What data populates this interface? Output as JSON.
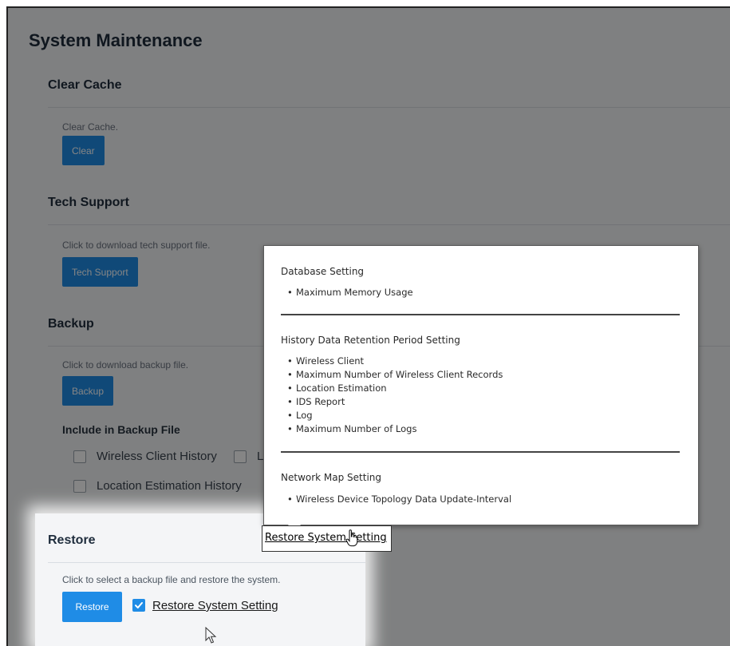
{
  "page": {
    "title": "System Maintenance"
  },
  "clear_cache": {
    "title": "Clear Cache",
    "description": "Clear Cache.",
    "button": "Clear"
  },
  "tech_support": {
    "title": "Tech Support",
    "description": "Click to download tech support file.",
    "button": "Tech Support"
  },
  "backup": {
    "title": "Backup",
    "description": "Click to download backup file.",
    "button": "Backup",
    "include_label": "Include in Backup File",
    "options": [
      "Wireless Client History",
      "L",
      "Location Estimation History"
    ]
  },
  "restore": {
    "title": "Restore",
    "description": "Click to select a backup file and restore the system.",
    "button": "Restore",
    "checkbox_label": "Restore System Setting",
    "checkbox_checked": true
  },
  "tooltip": {
    "sections": [
      {
        "heading": "Database Setting",
        "items": [
          "Maximum Memory Usage"
        ]
      },
      {
        "heading": "History Data Retention Period Setting",
        "items": [
          "Wireless Client",
          "Maximum Number of Wireless Client Records",
          "Location Estimation",
          "IDS Report",
          "Log",
          "Maximum Number of Logs"
        ]
      },
      {
        "heading": "Network Map Setting",
        "items": [
          "Wireless Device Topology Data Update-Interval"
        ]
      }
    ]
  },
  "hover_link": {
    "label": "Restore System Setting"
  },
  "colors": {
    "primary": "#1f8ce6",
    "overlay": "rgba(0,0,0,0.48)"
  },
  "icons": [
    "checkmark-icon",
    "hand-pointer-icon",
    "arrow-cursor-icon"
  ]
}
